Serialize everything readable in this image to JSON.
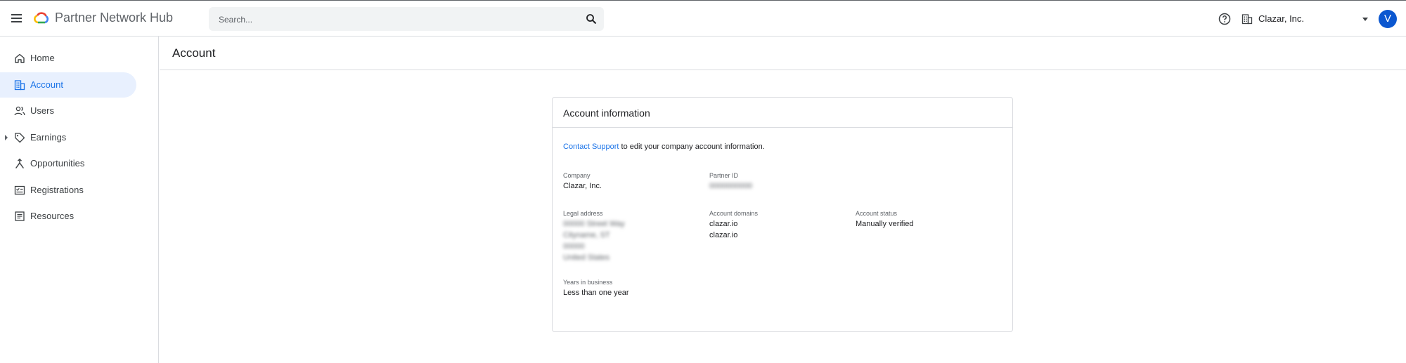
{
  "header": {
    "app_title": "Partner Network Hub",
    "search_placeholder": "Search...",
    "org_name": "Clazar, Inc.",
    "avatar_initial": "V",
    "icons": {
      "menu": "hamburger-menu-icon",
      "logo": "google-cloud-logo",
      "search": "search-icon",
      "help": "help-circle-icon",
      "org": "building-icon",
      "dropdown": "caret-down-icon"
    }
  },
  "sidebar": {
    "items": [
      {
        "label": "Home",
        "icon": "home-icon",
        "active": false
      },
      {
        "label": "Account",
        "icon": "building-icon",
        "active": true
      },
      {
        "label": "Users",
        "icon": "users-icon",
        "active": false
      },
      {
        "label": "Earnings",
        "icon": "tag-icon",
        "active": false,
        "expandable": true
      },
      {
        "label": "Opportunities",
        "icon": "merge-icon",
        "active": false
      },
      {
        "label": "Registrations",
        "icon": "registration-icon",
        "active": false
      },
      {
        "label": "Resources",
        "icon": "document-icon",
        "active": false
      }
    ]
  },
  "page": {
    "title": "Account"
  },
  "card": {
    "title": "Account information",
    "support_link": "Contact Support",
    "support_text": " to edit your company account information.",
    "company_label": "Company",
    "company_value": "Clazar, Inc.",
    "partner_id_label": "Partner ID",
    "partner_id_value": "0000000000",
    "legal_address_label": "Legal address",
    "legal_address_lines": [
      "00000 Street Way",
      "Cityname, ST",
      "00000",
      "United States"
    ],
    "account_domains_label": "Account domains",
    "account_domains": [
      "clazar.io",
      "clazar.io"
    ],
    "account_status_label": "Account status",
    "account_status_value": "Manually verified",
    "years_label": "Years in business",
    "years_value": "Less than one year"
  },
  "colors": {
    "accent": "#1a73e8",
    "active_bg": "#e8f0fe",
    "avatar_bg": "#0b57d0",
    "border": "#dadce0"
  }
}
